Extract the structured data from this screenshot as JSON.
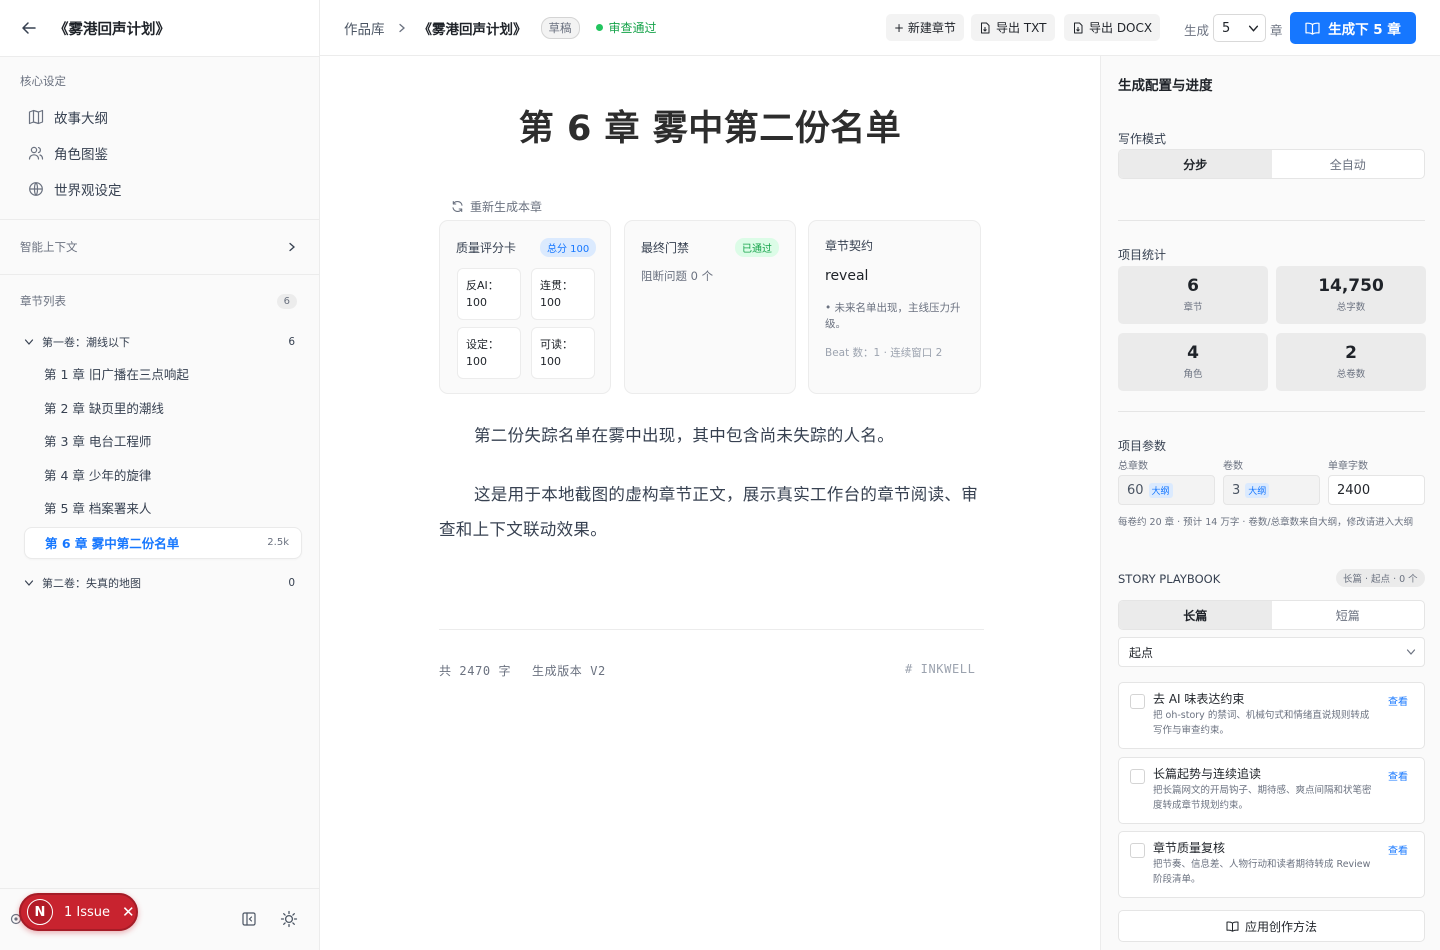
{
  "sidebar": {
    "title": "《雾港回声计划》",
    "core_label": "核心设定",
    "core_items": [
      {
        "label": "故事大纲",
        "icon": "book-map-icon"
      },
      {
        "label": "角色图鉴",
        "icon": "users-icon"
      },
      {
        "label": "世界观设定",
        "icon": "globe-icon"
      }
    ],
    "smart_context_label": "智能上下文",
    "chapter_list_label": "章节列表",
    "chapter_count": "6",
    "volume1": {
      "label": "第一卷：潮线以下",
      "count": "6"
    },
    "chapters": [
      "第 1 章 旧广播在三点响起",
      "第 2 章 缺页里的潮线",
      "第 3 章 电台工程师",
      "第 4 章 少年的旋律",
      "第 5 章 档案署来人"
    ],
    "active_chapter": {
      "label": "第 6 章 雾中第二份名单",
      "word_count": "2.5k"
    },
    "volume2": {
      "label": "第二卷：失真的地图",
      "count": "0"
    },
    "issue_badge": {
      "initial": "N",
      "text": "1 Issue",
      "close": "✕"
    }
  },
  "topbar": {
    "crumb_root": "作品库",
    "crumb_current": "《雾港回声计划》",
    "draft_badge": "草稿",
    "review_status": "审查通过",
    "new_chapter": "+ 新建章节",
    "export_txt": "导出 TXT",
    "export_docx": "导出 DOCX",
    "gen_prefix": "生成",
    "gen_count": "5",
    "gen_suffix": "章",
    "gen_button": "生成下 5 章"
  },
  "main": {
    "chapter_title": "第 6 章 雾中第二份名单",
    "regenerate": "重新生成本章",
    "quality_card": {
      "title": "质量评分卡",
      "total": "总分 100",
      "scores": [
        {
          "label": "反AI：",
          "value": "100"
        },
        {
          "label": "连贯：",
          "value": "100"
        },
        {
          "label": "设定：",
          "value": "100"
        },
        {
          "label": "可读：",
          "value": "100"
        }
      ]
    },
    "gate_card": {
      "title": "最终门禁",
      "status": "已通过",
      "blocking": "阻断问题 0 个"
    },
    "contract_card": {
      "title": "章节契约",
      "keyword": "reveal",
      "bullet": "• 未来名单出现，主线压力升级。",
      "beat": "Beat 数：1 · 连续窗口 2"
    },
    "paragraphs": [
      "第二份失踪名单在雾中出现，其中包含尚未失踪的人名。",
      "这是用于本地截图的虚构章节正文，展示真实工作台的章节阅读、审查和上下文联动效果。"
    ],
    "footer_words": "共 2470 字",
    "footer_version": "生成版本 V2",
    "footer_brand": "# INKWELL"
  },
  "panel": {
    "title": "生成配置与进度",
    "write_mode_label": "写作模式",
    "write_modes": [
      "分步",
      "全自动"
    ],
    "stats_label": "项目统计",
    "stats": [
      {
        "value": "6",
        "label": "章节"
      },
      {
        "value": "14,750",
        "label": "总字数"
      },
      {
        "value": "4",
        "label": "角色"
      },
      {
        "value": "2",
        "label": "总卷数"
      }
    ],
    "params_label": "项目参数",
    "param_total_label": "总章数",
    "param_total_value": "60",
    "param_volumes_label": "卷数",
    "param_volumes_value": "3",
    "param_outline_tag": "大纲",
    "param_words_label": "单章字数",
    "param_words_value": "2400",
    "param_note": "每卷约 20 章 · 预计 14 万字 · 卷数/总章数来自大纲，修改请进入大纲",
    "playbook_label": "STORY PLAYBOOK",
    "playbook_tag": "长篇 · 起点 · 0 个",
    "playbook_modes": [
      "长篇",
      "短篇"
    ],
    "platform": "起点",
    "methods": [
      {
        "title": "去 AI 味表达约束",
        "desc": "把 oh-story 的禁词、机械句式和情绪直说规则转成写作与审查约束。",
        "view": "查看"
      },
      {
        "title": "长篇起势与连续追读",
        "desc": "把长篇网文的开局钩子、期待感、爽点间隔和状笔密度转成章节规划约束。",
        "view": "查看"
      },
      {
        "title": "章节质量复核",
        "desc": "把节奏、信息差、人物行动和读者期待转成 Review 阶段清单。",
        "view": "查看"
      }
    ],
    "apply_button": "应用创作方法"
  },
  "colors": {
    "accent": "#1677ff",
    "success": "#16a34a",
    "danger": "#c8232f"
  }
}
